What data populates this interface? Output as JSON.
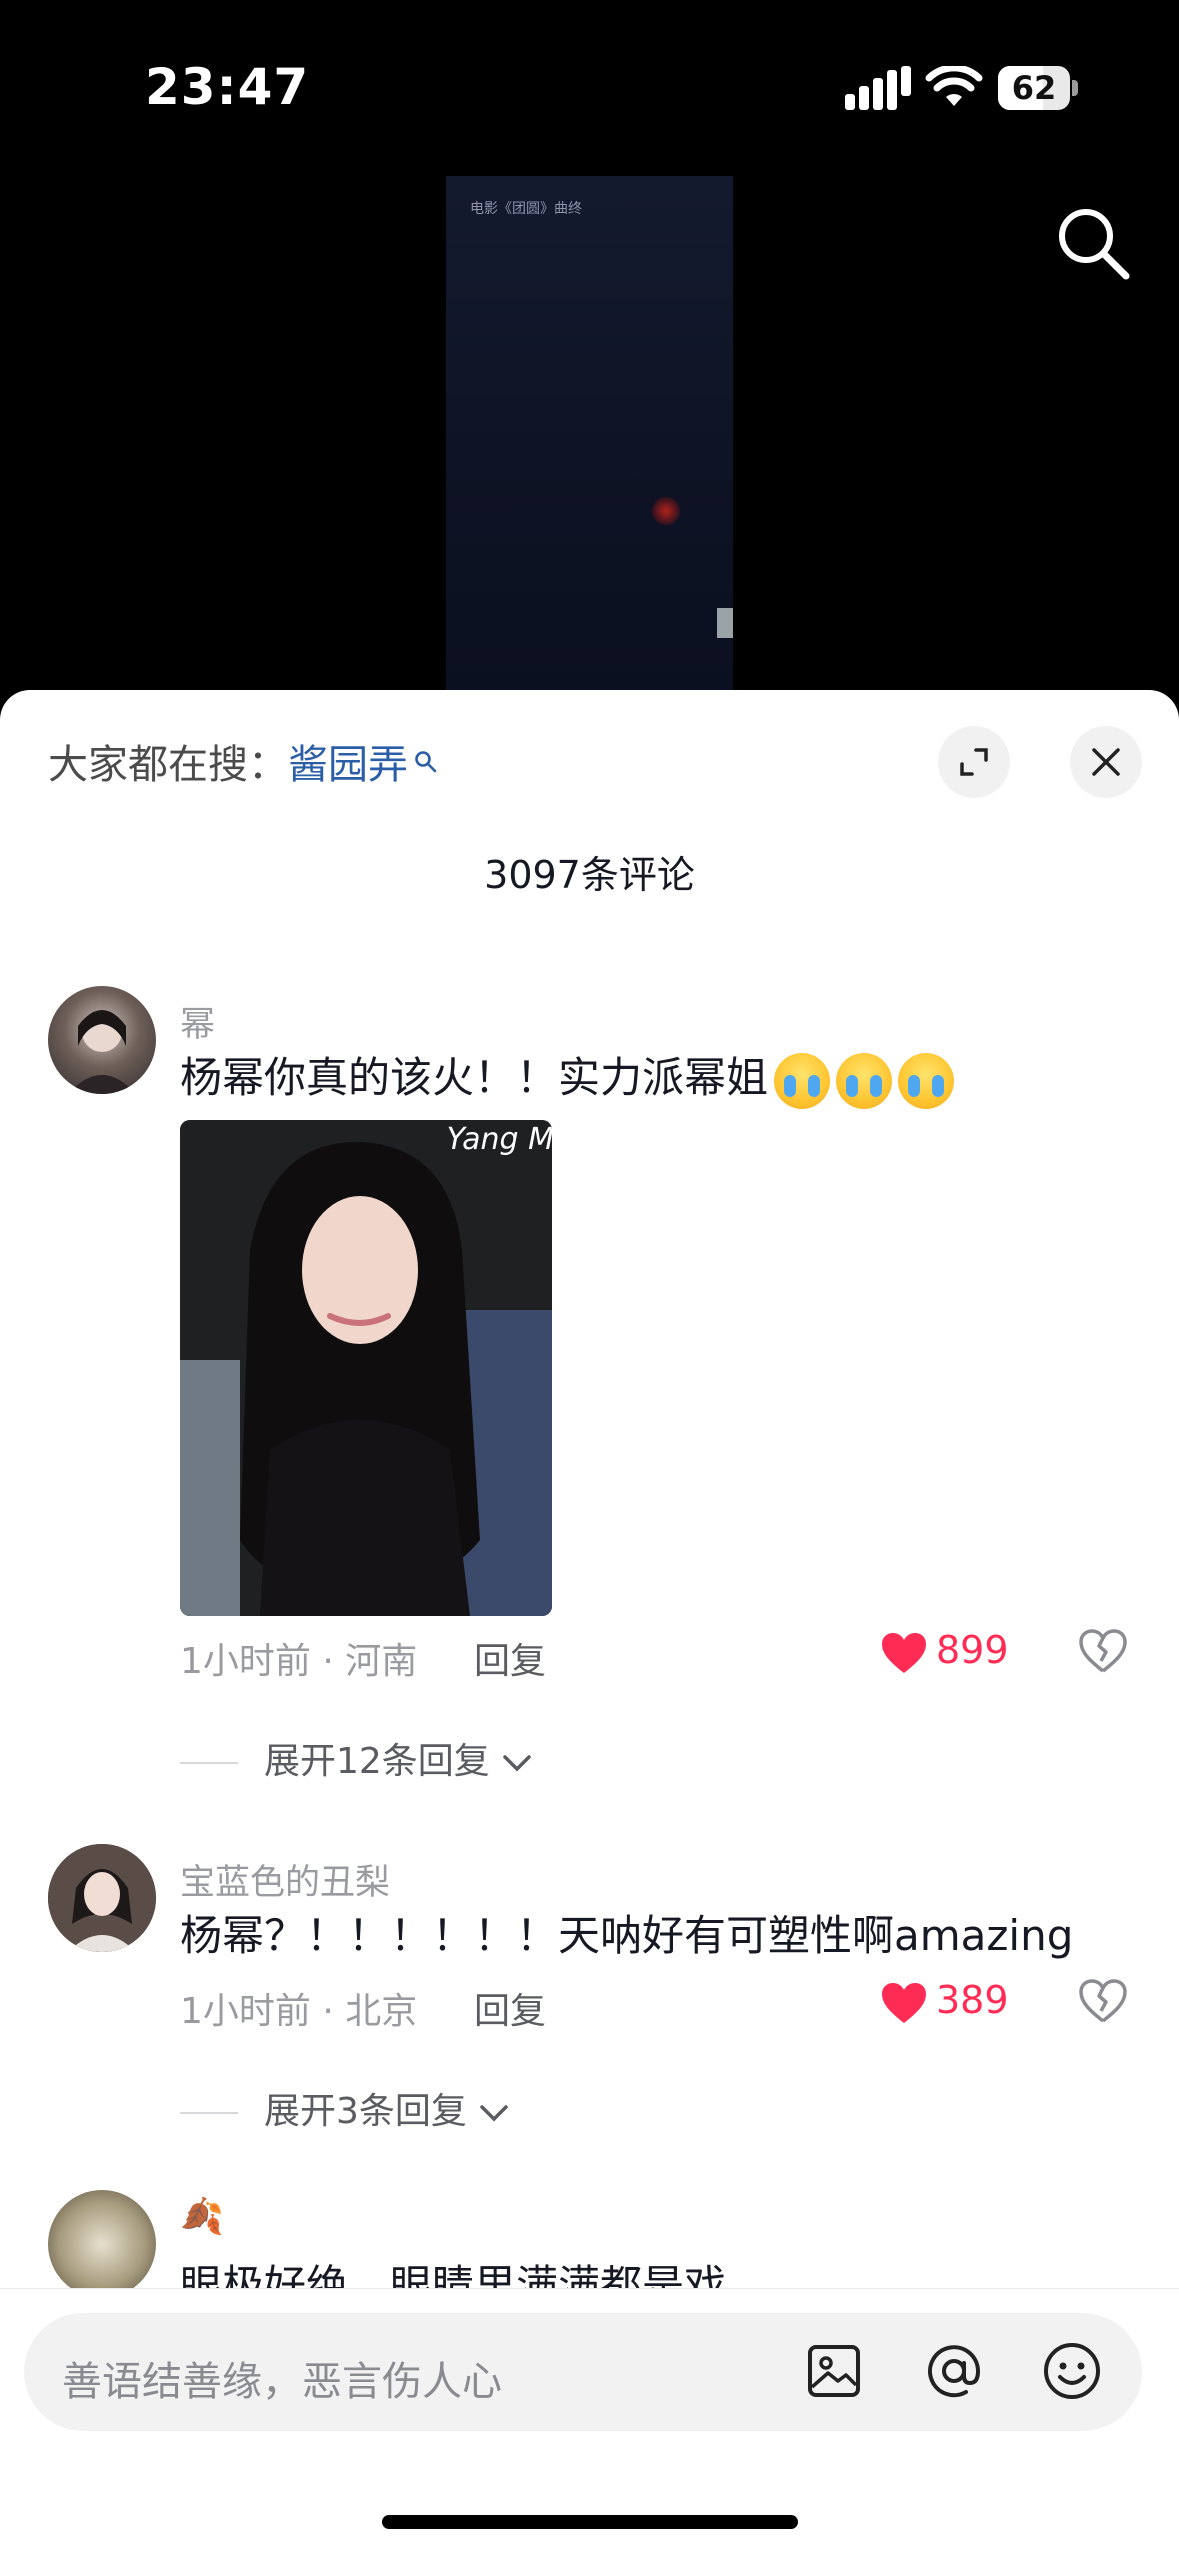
{
  "status": {
    "time": "23:47",
    "battery": "62"
  },
  "video": {
    "caption": "电影《团圆》曲终"
  },
  "sheet": {
    "trend_prefix": "大家都在搜：",
    "trend_keyword": "酱园弄",
    "comment_count": "3097条评论"
  },
  "comments": [
    {
      "user": "幂",
      "text": "杨幂你真的该火！！实力派幂姐",
      "photo_caption": "Yang M",
      "meta": "1小时前 · 河南",
      "reply": "回复",
      "likes": "899",
      "expand": "展开12条回复"
    },
    {
      "user": "宝蓝色的丑梨",
      "text": "杨幂？！！！！！！天呐好有可塑性啊amazing",
      "meta": "1小时前 · 北京",
      "reply": "回复",
      "likes": "389",
      "expand": "展开3条回复"
    },
    {
      "user": "🍂",
      "text": "眼极好绝，眼睛里满满都是戏"
    }
  ],
  "input": {
    "placeholder": "善语结善缘，恶言伤人心"
  },
  "colors": {
    "like": "#fe2c55",
    "keyword": "#2b5ea7",
    "background": "#000000"
  }
}
